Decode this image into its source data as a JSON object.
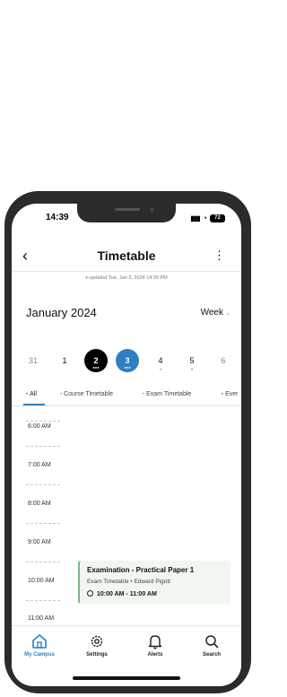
{
  "status": {
    "time": "14:39",
    "battery": "72"
  },
  "header": {
    "title": "Timetable"
  },
  "updated_text": "updated Tue, Jan 2, 2024 14:39 PM",
  "calendar": {
    "month": "January 2024",
    "view": "Week",
    "days": [
      "31",
      "1",
      "2",
      "3",
      "4",
      "5",
      "6"
    ]
  },
  "filters": [
    "All",
    "Course Timetable",
    "Exam Timetable",
    "Ever"
  ],
  "timeline": {
    "times": [
      "6:00 AM",
      "7:00 AM",
      "8:00 AM",
      "9:00 AM",
      "10:00 AM",
      "11:00 AM"
    ]
  },
  "event": {
    "title": "Examination - Practical Paper 1",
    "subtitle": "Exam Timetable • Edward Pigott",
    "time": "10:00 AM - 11:00 AM"
  },
  "tabs": [
    {
      "label": "My Campus",
      "icon": "home-icon"
    },
    {
      "label": "Settings",
      "icon": "gear-icon"
    },
    {
      "label": "Alerts",
      "icon": "bell-icon"
    },
    {
      "label": "Search",
      "icon": "search-icon"
    }
  ],
  "colors": {
    "accent": "#2d7fc1",
    "selected_day": "#000000",
    "event_bar": "#7bb48d",
    "phone_frame": "#2b2b2b"
  }
}
